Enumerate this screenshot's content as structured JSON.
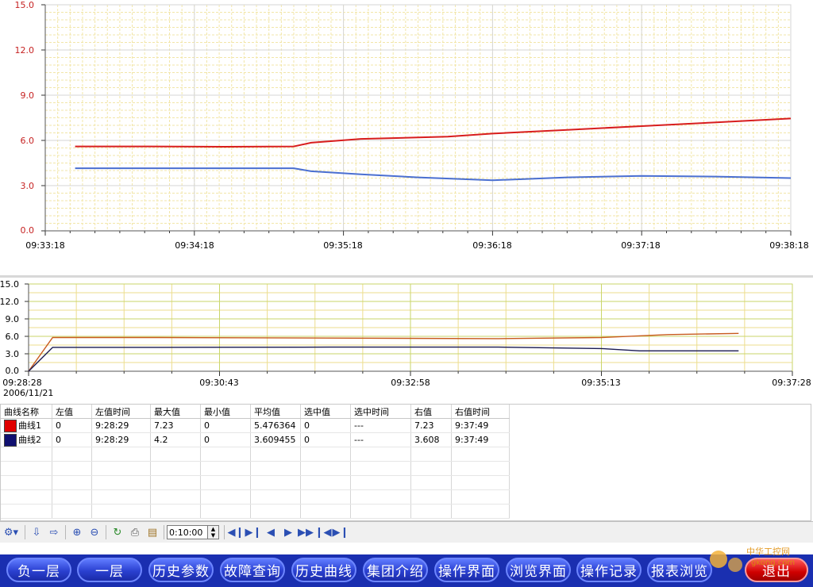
{
  "top_chart_axis": {
    "y_ticks": [
      "15.0",
      "12.0",
      "9.0",
      "6.0",
      "3.0",
      "0.0"
    ],
    "x_ticks": [
      "09:33:18",
      "09:34:18",
      "09:35:18",
      "09:36:18",
      "09:37:18",
      "09:38:18"
    ]
  },
  "overview_axis": {
    "y_ticks": [
      "15.0",
      "12.0",
      "9.0",
      "6.0",
      "3.0",
      "0.0"
    ],
    "x_ticks": [
      "09:28:28",
      "09:30:43",
      "09:32:58",
      "09:35:13",
      "09:37:28"
    ],
    "date": "2006/11/21"
  },
  "chart_data": [
    {
      "type": "line",
      "title": "",
      "xlabel": "",
      "ylabel": "",
      "ylim": [
        0,
        15
      ],
      "xlim": [
        "09:33:18",
        "09:38:18"
      ],
      "grid": true,
      "series": [
        {
          "name": "曲线1",
          "color": "#d81d1d",
          "points": [
            [
              "09:33:30",
              5.6
            ],
            [
              "09:34:00",
              5.6
            ],
            [
              "09:34:30",
              5.58
            ],
            [
              "09:34:58",
              5.6
            ],
            [
              "09:35:05",
              5.85
            ],
            [
              "09:35:25",
              6.1
            ],
            [
              "09:36:00",
              6.25
            ],
            [
              "09:36:18",
              6.45
            ],
            [
              "09:36:48",
              6.7
            ],
            [
              "09:37:18",
              6.95
            ],
            [
              "09:37:48",
              7.2
            ],
            [
              "09:38:18",
              7.45
            ]
          ]
        },
        {
          "name": "曲线2",
          "color": "#4a6fd1",
          "points": [
            [
              "09:33:30",
              4.15
            ],
            [
              "09:34:00",
              4.15
            ],
            [
              "09:34:30",
              4.15
            ],
            [
              "09:34:58",
              4.15
            ],
            [
              "09:35:05",
              3.95
            ],
            [
              "09:35:25",
              3.75
            ],
            [
              "09:35:48",
              3.55
            ],
            [
              "09:36:18",
              3.35
            ],
            [
              "09:36:48",
              3.55
            ],
            [
              "09:37:18",
              3.65
            ],
            [
              "09:37:48",
              3.6
            ],
            [
              "09:38:18",
              3.5
            ]
          ]
        }
      ]
    },
    {
      "type": "line",
      "title": "",
      "xlabel": "",
      "ylabel": "",
      "ylim": [
        0,
        15
      ],
      "xlim": [
        "09:28:28",
        "09:37:28"
      ],
      "grid": true,
      "series": [
        {
          "name": "曲线1",
          "color": "#c85a1e",
          "points": [
            [
              "09:28:28",
              0.0
            ],
            [
              "09:28:45",
              5.8
            ],
            [
              "09:30:00",
              5.8
            ],
            [
              "09:32:00",
              5.7
            ],
            [
              "09:34:00",
              5.6
            ],
            [
              "09:35:13",
              5.8
            ],
            [
              "09:36:00",
              6.3
            ],
            [
              "09:36:50",
              6.5
            ]
          ]
        },
        {
          "name": "曲线2",
          "color": "#1a1a50",
          "points": [
            [
              "09:28:28",
              0.0
            ],
            [
              "09:28:45",
              4.1
            ],
            [
              "09:30:00",
              4.1
            ],
            [
              "09:32:00",
              4.15
            ],
            [
              "09:34:00",
              4.15
            ],
            [
              "09:35:13",
              3.9
            ],
            [
              "09:35:40",
              3.5
            ],
            [
              "09:36:50",
              3.5
            ]
          ]
        }
      ]
    }
  ],
  "table": {
    "headers": [
      "曲线名称",
      "左值",
      "左值时间",
      "最大值",
      "最小值",
      "平均值",
      "选中值",
      "选中时间",
      "右值",
      "右值时间"
    ],
    "rows": [
      {
        "color": "#e00000",
        "name": "曲线1",
        "cells": [
          "0",
          "9:28:29",
          "7.23",
          "0",
          "5.476364",
          "0",
          "---",
          "7.23",
          "9:37:49"
        ]
      },
      {
        "color": "#101070",
        "name": "曲线2",
        "cells": [
          "0",
          "9:28:29",
          "4.2",
          "0",
          "3.609455",
          "0",
          "---",
          "3.608",
          "9:37:49"
        ]
      }
    ]
  },
  "toolbar": {
    "time_value": "0:10:00"
  },
  "nav": {
    "buttons": [
      "负一层",
      "一层",
      "历史参数",
      "故障查询",
      "历史曲线",
      "集团介绍",
      "操作界面",
      "浏览界面",
      "操作记录",
      "报表浏览"
    ],
    "exit": "退出"
  },
  "watermark": {
    "cn": "中华工控网",
    "url": "gkong.com"
  }
}
